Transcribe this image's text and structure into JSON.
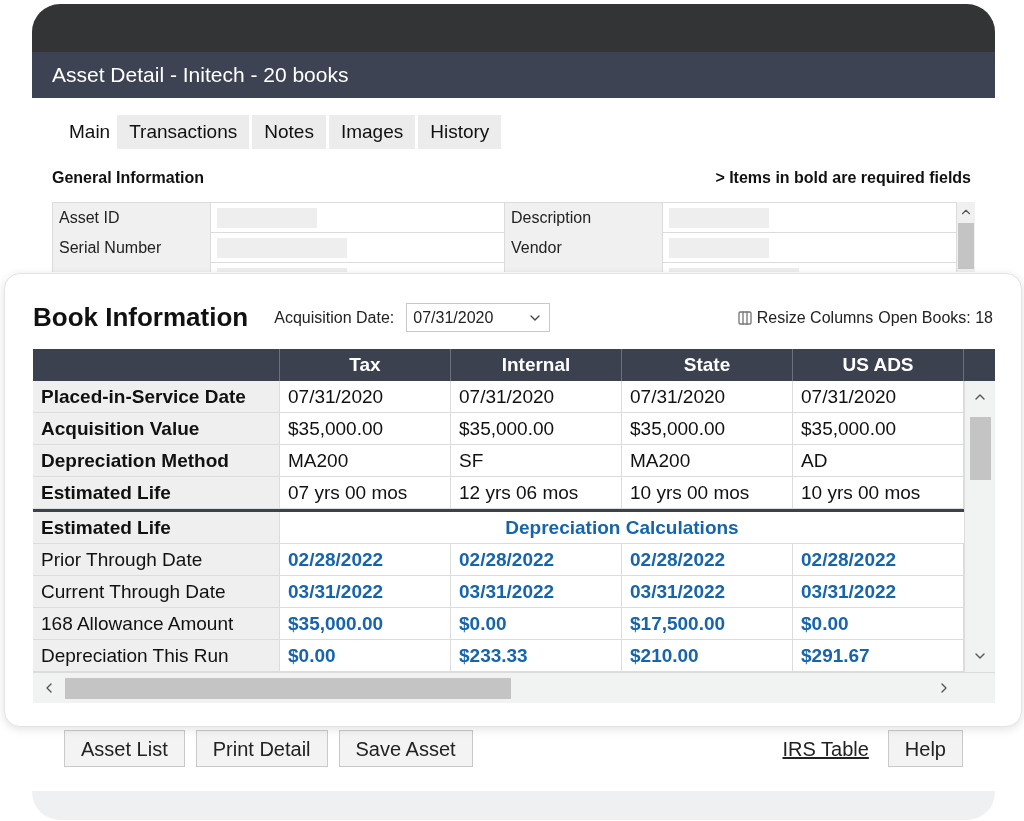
{
  "window": {
    "title": "Asset Detail - Initech - 20 books"
  },
  "tabs": [
    {
      "label": "Main",
      "selected": true
    },
    {
      "label": "Transactions",
      "selected": false
    },
    {
      "label": "Notes",
      "selected": false
    },
    {
      "label": "Images",
      "selected": false
    },
    {
      "label": "History",
      "selected": false
    }
  ],
  "general": {
    "title": "General Information",
    "note": "> Items in bold are required fields",
    "rows": [
      {
        "left": "Asset ID",
        "right": "Description"
      },
      {
        "left": "Serial Number",
        "right": "Vendor"
      }
    ]
  },
  "book": {
    "title": "Book Information",
    "acquisition_label": "Acquisition Date:",
    "acquisition_value": "07/31/2020",
    "resize_label": "Resize Columns",
    "open_books": "Open Books: 18",
    "columns": [
      "Tax",
      "Internal",
      "State",
      "US ADS"
    ],
    "rows": [
      {
        "label": "Placed-in-Service Date",
        "values": [
          "07/31/2020",
          "07/31/2020",
          "07/31/2020",
          "07/31/2020"
        ]
      },
      {
        "label": "Acquisition Value",
        "values": [
          "$35,000.00",
          "$35,000.00",
          "$35,000.00",
          "$35,000.00"
        ]
      },
      {
        "label": "Depreciation Method",
        "values": [
          "MA200",
          "SF",
          "MA200",
          "AD"
        ]
      },
      {
        "label": "Estimated Life",
        "values": [
          "07 yrs 00 mos",
          "12 yrs 06 mos",
          "10 yrs 00 mos",
          "10 yrs 00 mos"
        ]
      }
    ],
    "section": {
      "label": "Estimated Life",
      "title": "Depreciation Calculations"
    },
    "calc_rows": [
      {
        "label": "Prior Through Date",
        "values": [
          "02/28/2022",
          "02/28/2022",
          "02/28/2022",
          "02/28/2022"
        ]
      },
      {
        "label": "Current Through Date",
        "values": [
          "03/31/2022",
          "03/31/2022",
          "03/31/2022",
          "03/31/2022"
        ]
      },
      {
        "label": "168 Allowance Amount",
        "values": [
          "$35,000.00",
          "$0.00",
          "$17,500.00",
          "$0.00"
        ]
      },
      {
        "label": "Depreciation This Run",
        "values": [
          "$0.00",
          "$233.33",
          "$210.00",
          "$291.67"
        ]
      }
    ]
  },
  "buttons": [
    {
      "label": "Asset List",
      "kind": "button"
    },
    {
      "label": "Print Detail",
      "kind": "button"
    },
    {
      "label": "Save Asset",
      "kind": "button"
    },
    {
      "label": "IRS Table",
      "kind": "link"
    },
    {
      "label": "Help",
      "kind": "button"
    }
  ]
}
